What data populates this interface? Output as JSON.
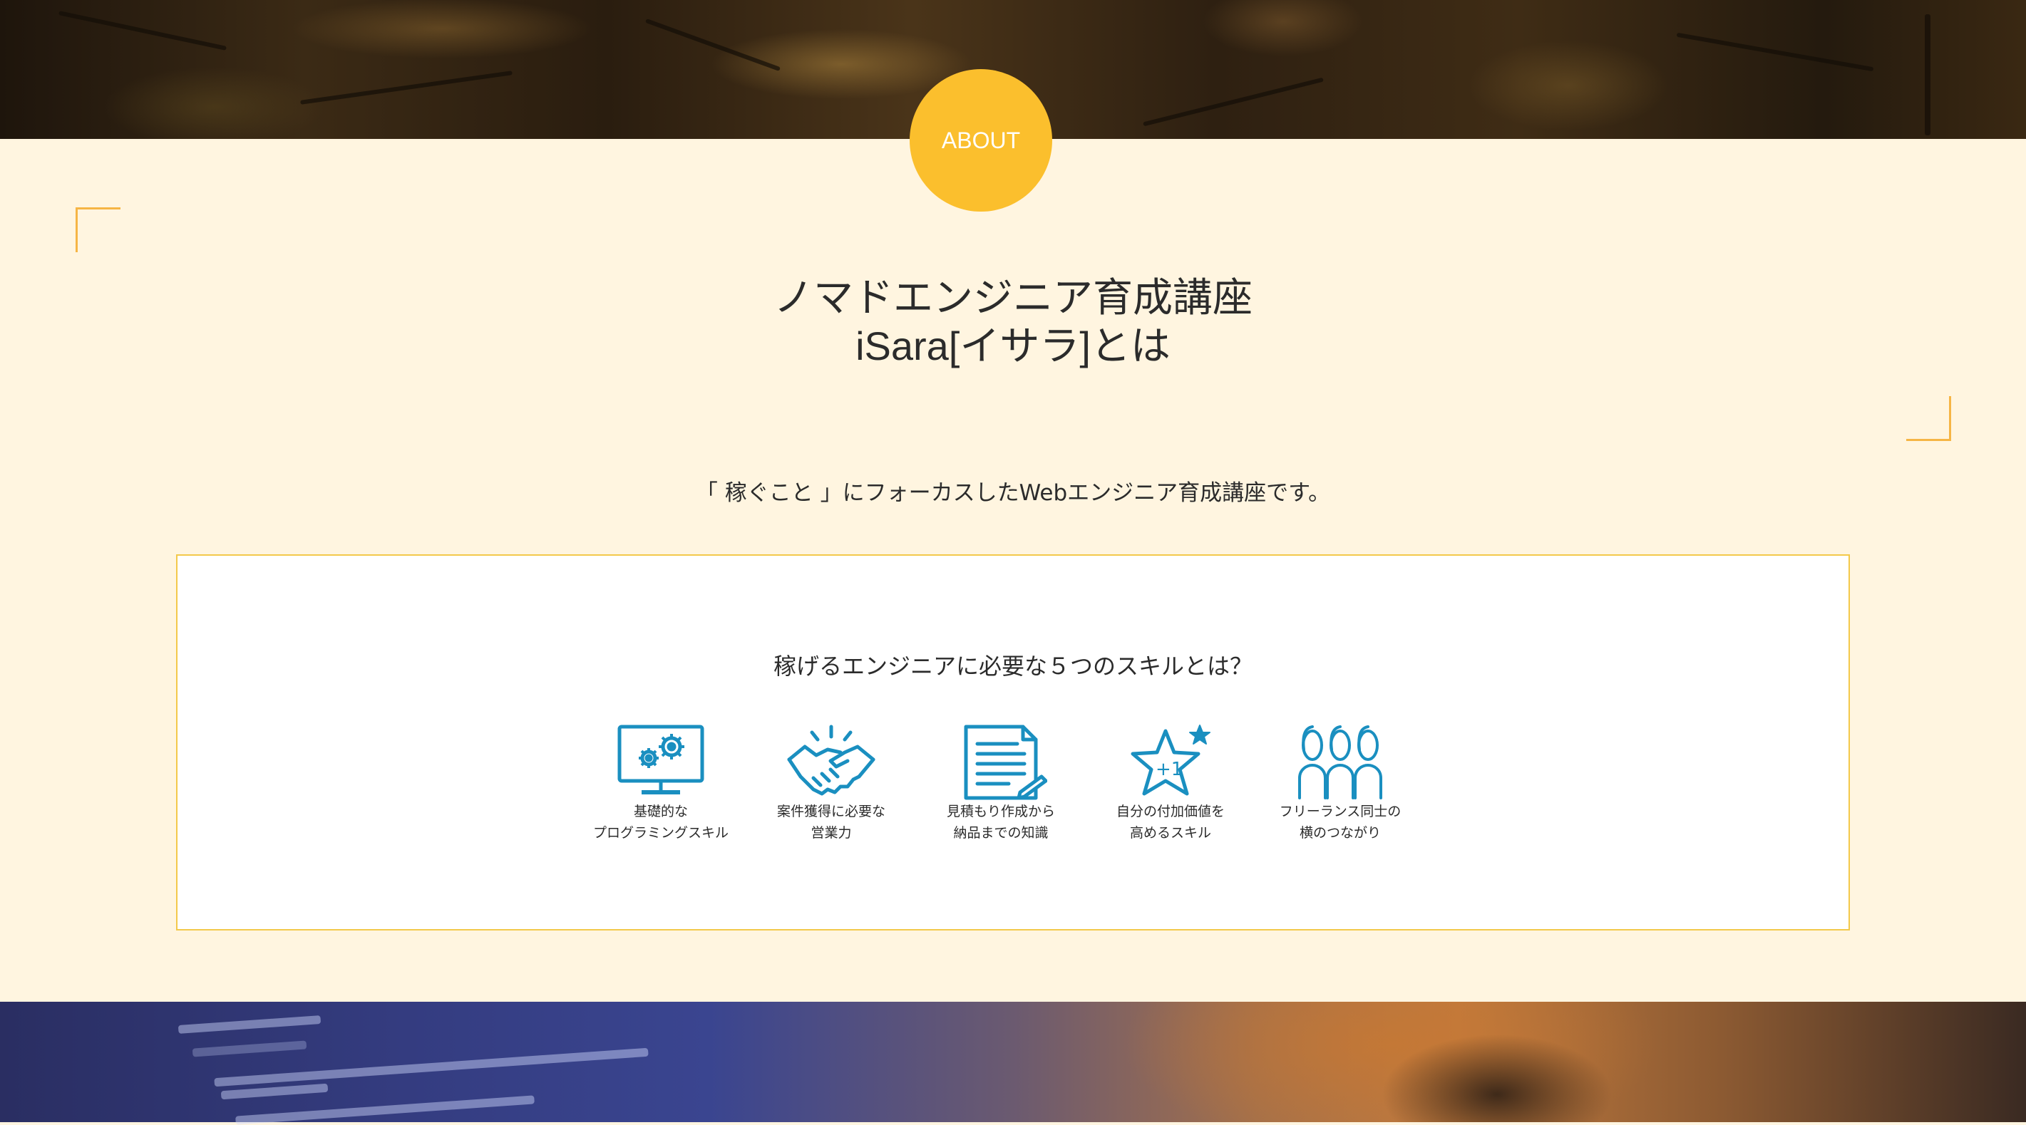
{
  "about_badge": "ABOUT",
  "heading": {
    "line1": "ノマドエンジニア育成講座",
    "line2": "iSara[イサラ]とは"
  },
  "lead": "「 稼ぐこと 」にフォーカスしたWebエンジニア育成講座です。",
  "skills": {
    "title": "稼げるエンジニアに必要な５つのスキルとは？",
    "items": [
      {
        "icon": "monitor-gears-icon",
        "line1": "基礎的な",
        "line2": "プログラミングスキル"
      },
      {
        "icon": "handshake-icon",
        "line1": "案件獲得に必要な",
        "line2": "営業力"
      },
      {
        "icon": "document-icon",
        "line1": "見積もり作成から",
        "line2": "納品までの知識"
      },
      {
        "icon": "star-plus-one-icon",
        "line1": "自分の付加価値を",
        "line2": "高めるスキル"
      },
      {
        "icon": "people-group-icon",
        "line1": "フリーランス同士の",
        "line2": "横のつながり"
      }
    ]
  },
  "colors": {
    "background": "#fff5e0",
    "accent": "#fbbf2d",
    "icon": "#1a8fc0",
    "box_border": "#f3c94a"
  }
}
